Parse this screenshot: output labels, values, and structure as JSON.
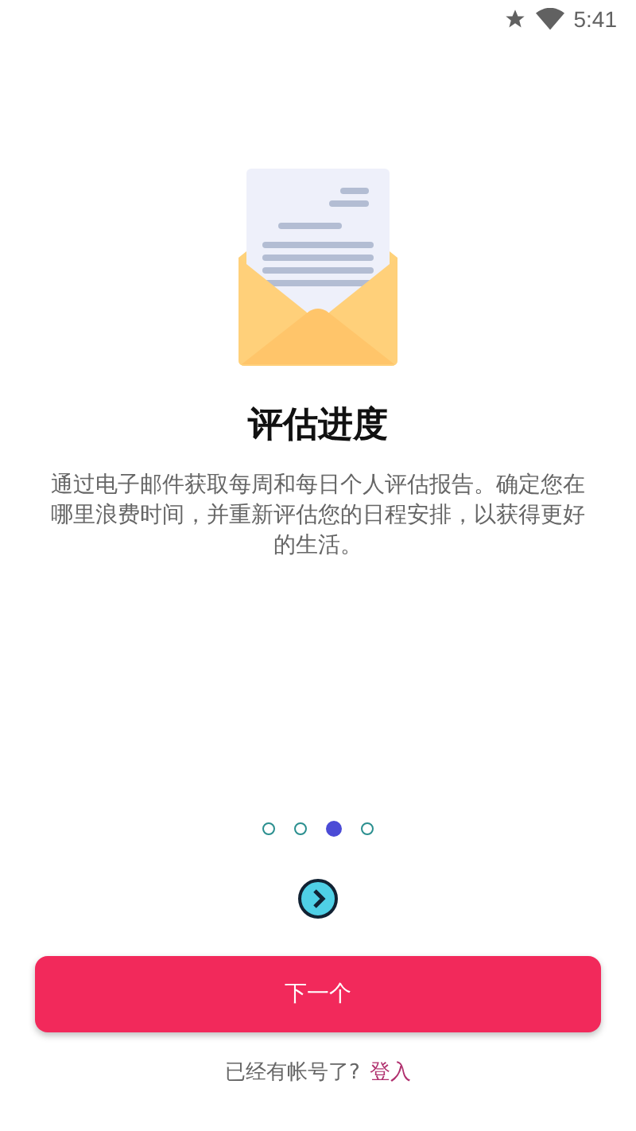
{
  "status_bar": {
    "time": "5:41"
  },
  "title": "评估进度",
  "description": "通过电子邮件获取每周和每日个人评估报告。确定您在哪里浪费时间，并重新评估您的日程安排，以获得更好的生活。",
  "pager": [
    {
      "selected": false
    },
    {
      "selected": false
    },
    {
      "selected": true
    },
    {
      "selected": false
    }
  ],
  "primary_button": "下一个",
  "footer": {
    "text": "已经有帐号了?",
    "link": "登入"
  }
}
